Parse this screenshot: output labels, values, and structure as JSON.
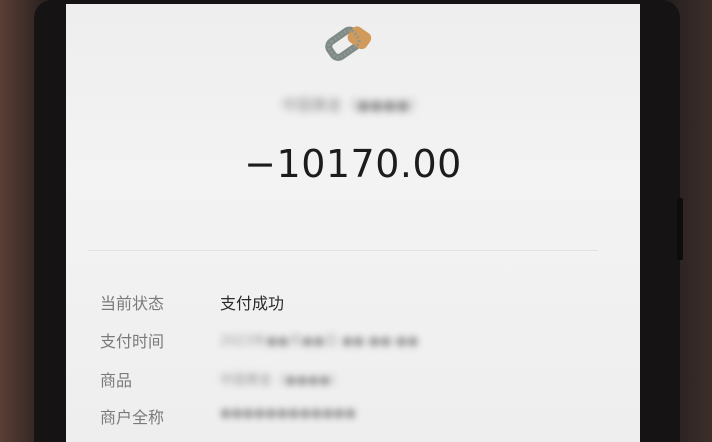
{
  "receipt": {
    "merchant_name": "中国黄金（●●●●）",
    "amount": "−10170.00",
    "details": [
      {
        "label": "当前状态",
        "value": "支付成功",
        "blurred": false
      },
      {
        "label": "支付时间",
        "value": "2023年●●月●●日 ●●:●●:●●",
        "blurred": true
      },
      {
        "label": "商品",
        "value": "中国黄金（●●●●）",
        "blurred": true
      },
      {
        "label": "商户全称",
        "value": "●●●●●●●●●●●●",
        "blurred": true
      }
    ]
  },
  "colors": {
    "logo_gray": "#7f8a86",
    "logo_gold": "#d29a5a",
    "screen_bg": "#f0f0f0",
    "amount_text": "#1c1c1c"
  },
  "icons": {
    "logo": "payment-brand-logo-icon"
  }
}
